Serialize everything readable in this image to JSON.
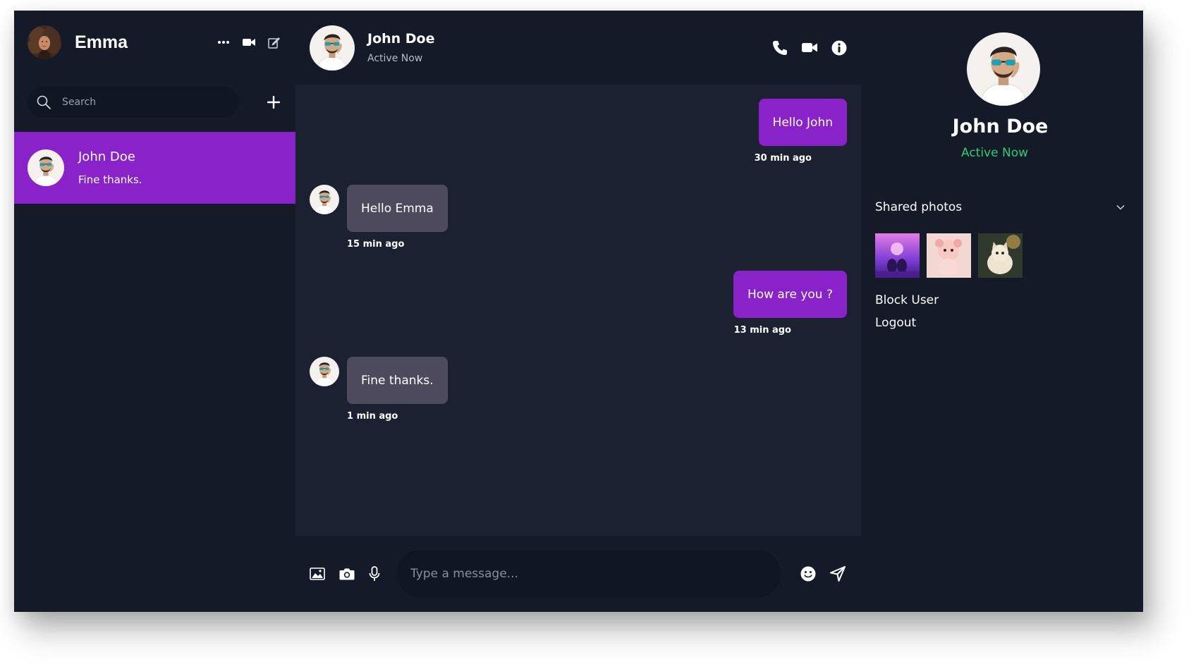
{
  "colors": {
    "app_background": "#151a28",
    "chat_background": "#1c2131",
    "accent_purple": "#8a22c9",
    "received_bubble": "#4d4a5e",
    "status_green": "#2ecc71"
  },
  "sidebar": {
    "user_name": "Emma",
    "header_icons": [
      "more-horizontal-icon",
      "video-camera-icon",
      "edit-icon"
    ],
    "search": {
      "placeholder": "Search",
      "value": ""
    },
    "conversations": [
      {
        "name": "John Doe",
        "last_message": "Fine thanks.",
        "selected": true
      }
    ]
  },
  "chat": {
    "contact_name": "John Doe",
    "contact_status": "Active Now",
    "header_icons": [
      "phone-icon",
      "video-camera-icon",
      "info-icon"
    ],
    "messages": [
      {
        "direction": "sent",
        "text": "Hello John",
        "time": "30 min ago"
      },
      {
        "direction": "received",
        "text": "Hello Emma",
        "time": "15 min ago"
      },
      {
        "direction": "sent",
        "text": "How are you ?",
        "time": "13 min ago"
      },
      {
        "direction": "received",
        "text": "Fine thanks.",
        "time": "1 min ago"
      }
    ],
    "composer": {
      "placeholder": "Type a message...",
      "value": "",
      "left_icons": [
        "image-icon",
        "camera-icon",
        "microphone-icon"
      ],
      "right_icons": [
        "emoji-icon",
        "send-icon"
      ]
    }
  },
  "details": {
    "name": "John Doe",
    "status": "Active Now",
    "shared_photos_label": "Shared photos",
    "shared_photos": [
      "purple-cats-photo",
      "pink-toy-photo",
      "kitten-photo"
    ],
    "actions": [
      "Block User",
      "Logout"
    ]
  }
}
